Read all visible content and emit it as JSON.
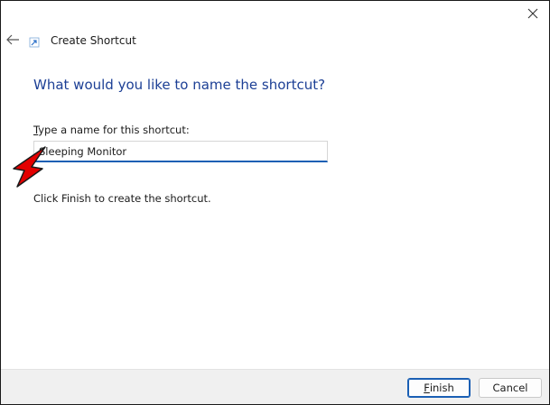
{
  "window": {
    "title": "Create Shortcut"
  },
  "page": {
    "heading": "What would you like to name the shortcut?",
    "field_label_mnemonic": "T",
    "field_label_rest": "ype a name for this shortcut:",
    "name_value": "Sleeping Monitor",
    "info_text": "Click Finish to create the shortcut."
  },
  "footer": {
    "finish_mnemonic": "F",
    "finish_rest": "inish",
    "cancel_label": "Cancel"
  },
  "colors": {
    "heading": "#1c3f95",
    "accent": "#1a5fb4",
    "annotation_arrow": "#e30000"
  },
  "icons": {
    "close": "close-icon",
    "back": "back-arrow-icon",
    "title": "shortcut-icon",
    "annotation": "red-arrow-icon"
  }
}
